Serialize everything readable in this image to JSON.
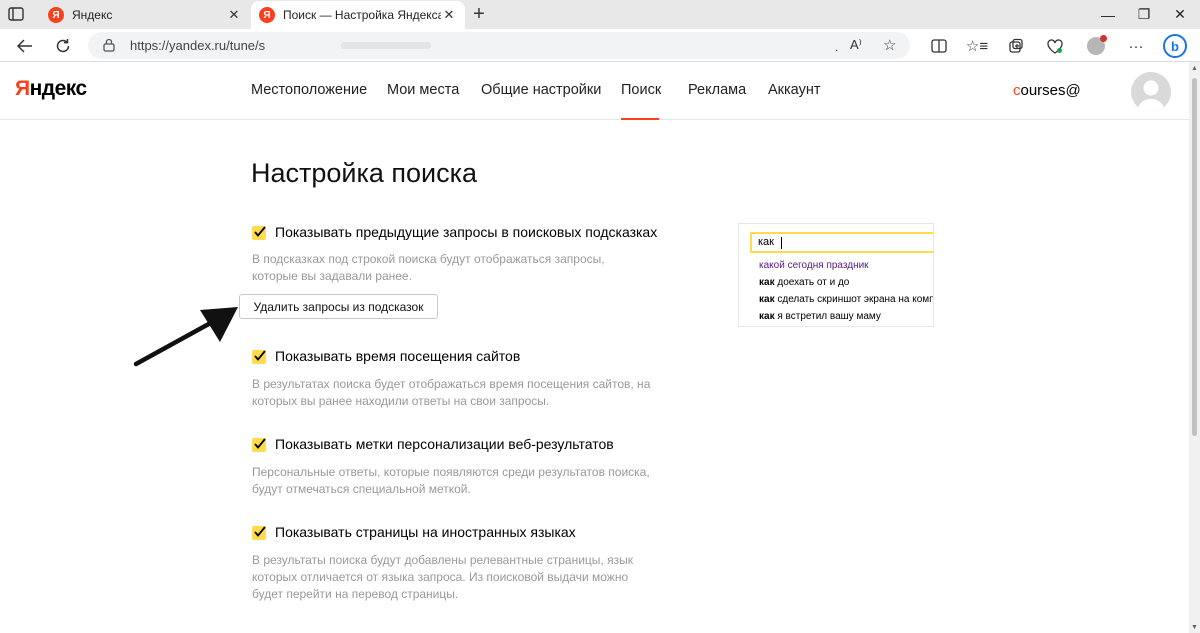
{
  "browser": {
    "tabs": [
      {
        "title": "Яндекс",
        "favicon": "Я",
        "active": false
      },
      {
        "title": "Поиск — Настройка Яндекса",
        "favicon": "Я",
        "active": true
      }
    ],
    "url": "https://yandex.ru/tune/s",
    "read_aloud": "A⁾",
    "icons": [
      "back-icon",
      "refresh-icon",
      "lock-icon",
      "star-icon",
      "split-screen-icon",
      "favorites-icon",
      "collections-icon",
      "health-icon",
      "profile-icon",
      "more-icon",
      "bing-icon"
    ]
  },
  "header": {
    "logo_first": "Я",
    "logo_rest": "ндекс",
    "nav": [
      {
        "label": "Местоположение"
      },
      {
        "label": "Мои места"
      },
      {
        "label": "Общие настройки"
      },
      {
        "label": "Поиск",
        "active": true
      },
      {
        "label": "Реклама"
      },
      {
        "label": "Аккаунт"
      }
    ],
    "user_first": "c",
    "user_rest": "ourses@"
  },
  "main": {
    "title": "Настройка поиска",
    "options": [
      {
        "label": "Показывать предыдущие запросы в поисковых подсказках",
        "checked": true,
        "desc": "В подсказках под строкой поиска будут отображаться запросы, которые вы задавали ранее."
      },
      {
        "label": "Показывать время посещения сайтов",
        "checked": true,
        "desc": "В результатах поиска будет отображаться время посещения сайтов, на которых вы ранее находили ответы на свои запросы."
      },
      {
        "label": "Показывать метки персонализации веб-результатов",
        "checked": true,
        "desc": "Персональные ответы, которые появляются среди результатов поиска, будут отмечаться специальной меткой."
      },
      {
        "label": "Показывать страницы на иностранных языках",
        "checked": true,
        "desc": "В результаты поиска будут добавлены релевантные страницы, язык которых отличается от языка запроса. Из поисковой выдачи можно будет перейти на перевод страницы."
      }
    ],
    "clear_button": "Удалить запросы из подсказок"
  },
  "preview": {
    "query": "как",
    "suggestions": [
      {
        "bold": "",
        "rest": "какой сегодня праздник",
        "visited": true
      },
      {
        "bold": "как",
        "rest": " доехать от и до",
        "visited": false
      },
      {
        "bold": "как",
        "rest": " сделать скриншот экрана на компь",
        "visited": false
      },
      {
        "bold": "как",
        "rest": " я встретил вашу маму",
        "visited": false
      }
    ]
  },
  "colors": {
    "accent": "#fc3f1d",
    "checkbox": "#ffdb4d",
    "muted_text": "#999999",
    "visited_link": "#551a8b"
  }
}
